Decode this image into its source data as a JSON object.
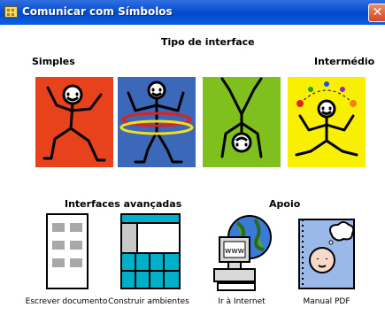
{
  "window": {
    "title": "Comunicar com Símbolos",
    "close_glyph": "✕"
  },
  "main": {
    "interface_heading": "Tipo de interface",
    "simple_label": "Simples",
    "intermediate_label": "Intermédio",
    "advanced_heading": "Interfaces avançadas",
    "support_heading": "Apoio"
  },
  "interface_tiles": [
    {
      "icon": "dancing-figure-icon",
      "color": "#e8421c"
    },
    {
      "icon": "hula-hoop-figure-icon",
      "color": "#3b68b9"
    },
    {
      "icon": "handstand-figure-icon",
      "color": "#7fbf1e"
    },
    {
      "icon": "juggling-figure-icon",
      "color": "#f8f000"
    }
  ],
  "tools": [
    {
      "label": "Escrever documento",
      "icon": "document-icon"
    },
    {
      "label": "Construir ambientes",
      "icon": "grid-layout-icon"
    },
    {
      "label": "Ir à Internet",
      "icon": "internet-globe-icon"
    },
    {
      "label": "Manual PDF",
      "icon": "manual-book-icon"
    }
  ]
}
